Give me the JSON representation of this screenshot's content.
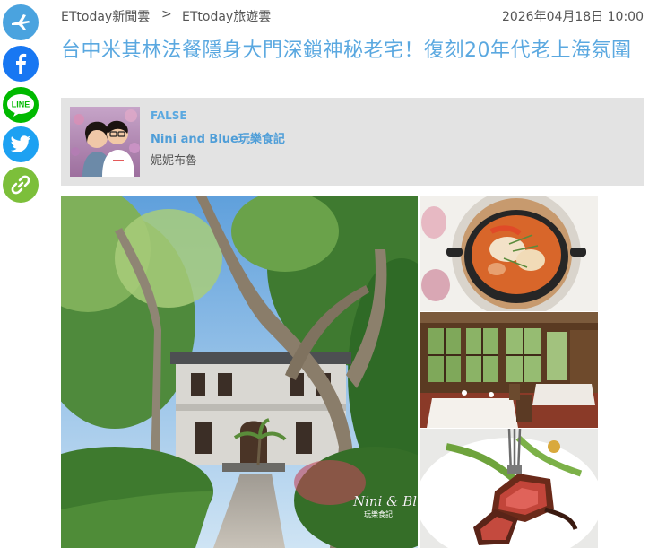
{
  "share": {
    "items": [
      {
        "name": "plane-icon",
        "label": "share"
      },
      {
        "name": "facebook-icon",
        "label": "f"
      },
      {
        "name": "line-icon",
        "label": "LINE"
      },
      {
        "name": "twitter-icon",
        "label": "twitter"
      },
      {
        "name": "link-icon",
        "label": "link"
      }
    ],
    "colors": {
      "plane": "#4aa3df",
      "facebook": "#1877f2",
      "line": "#00b900",
      "twitter": "#1da1f2",
      "link": "#7cbf3a"
    }
  },
  "breadcrumb": {
    "items": [
      "ETtoday新聞雲",
      "ETtoday旅遊雲"
    ],
    "separator": ">"
  },
  "article": {
    "date": "2026年04月18日 10:00",
    "title": "台中米其林法餐隱身大門深鎖神秘老宅！復刻20年代老上海氛圍"
  },
  "author": {
    "tag": "FALSE",
    "name": "Nini and Blue玩樂食記",
    "sub": "妮妮布魯"
  },
  "gallery": {
    "watermark": "Nini & Blue",
    "watermark_sub": "玩樂食記"
  },
  "colors": {
    "title": "#5aa8e0",
    "author_bg": "#e3e3e3",
    "accent": "#4f9ed8"
  }
}
